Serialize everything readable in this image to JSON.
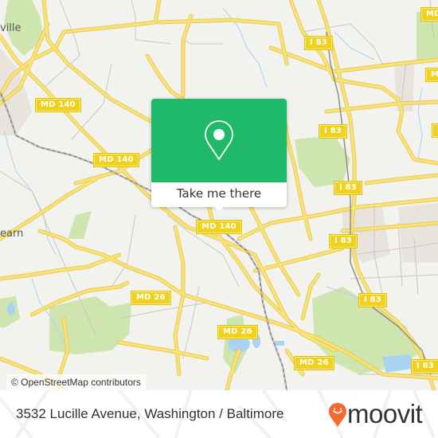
{
  "map": {
    "background_color": "#f2f2ee",
    "road_color": "#f7dd5f",
    "park_color": "#c9e3a6",
    "water_color": "#a9d3f0",
    "place_labels": [
      {
        "id": "place-label-top-left",
        "text": "ville"
      },
      {
        "id": "place-label-left",
        "text": "earn"
      }
    ],
    "shields": [
      {
        "id": "md140-a",
        "text": "MD 140"
      },
      {
        "id": "md140-b",
        "text": "MD 140"
      },
      {
        "id": "md140-c",
        "text": "MD 140"
      },
      {
        "id": "i83-a",
        "text": "I 83"
      },
      {
        "id": "i83-b",
        "text": "I 83"
      },
      {
        "id": "i83-c",
        "text": "I 83"
      },
      {
        "id": "i83-d",
        "text": "I 83"
      },
      {
        "id": "i83-e",
        "text": "I 83"
      },
      {
        "id": "i83-f",
        "text": "I 83"
      },
      {
        "id": "md26-a",
        "text": "MD 26"
      },
      {
        "id": "md26-b",
        "text": "MD 26"
      },
      {
        "id": "md26-c",
        "text": "MD 26"
      },
      {
        "id": "md-partial-a",
        "text": "MD"
      },
      {
        "id": "md-partial-b",
        "text": "M"
      },
      {
        "id": "md-partial-c",
        "text": "I"
      }
    ],
    "attribution": "© OpenStreetMap contributors"
  },
  "popup": {
    "icon": "map-pin-icon",
    "accent_color": "#1fb96a",
    "cta_label": "Take me there"
  },
  "footer": {
    "address": "3532 Lucille Avenue, Washington / Baltimore",
    "brand": {
      "name": "moovit",
      "icon": "moovit-smiley-pin-icon",
      "color": "#f26a2e"
    }
  }
}
